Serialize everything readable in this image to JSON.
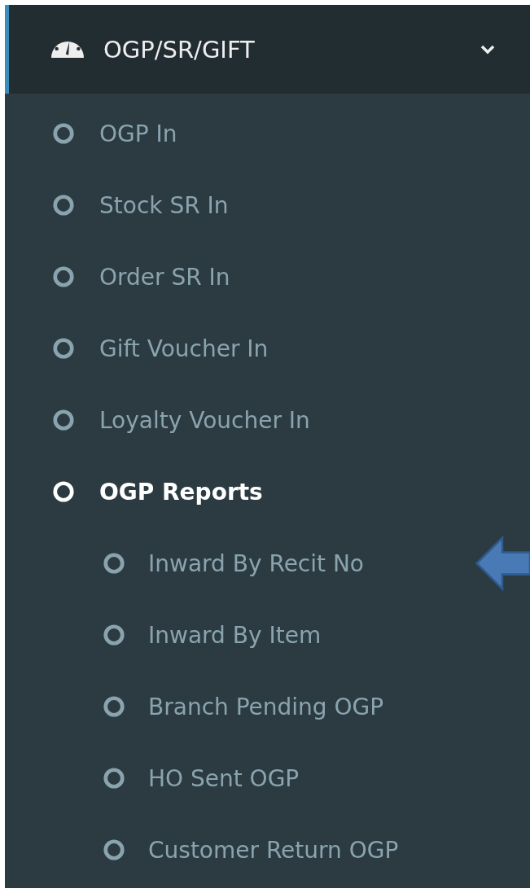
{
  "header": {
    "title": "OGP/SR/GIFT",
    "expanded": true
  },
  "items": [
    {
      "label": "OGP In",
      "active": false,
      "pointed": false
    },
    {
      "label": "Stock SR In",
      "active": false,
      "pointed": false
    },
    {
      "label": "Order SR In",
      "active": false,
      "pointed": false
    },
    {
      "label": "Gift Voucher In",
      "active": false,
      "pointed": false
    },
    {
      "label": "Loyalty Voucher In",
      "active": false,
      "pointed": false
    },
    {
      "label": "OGP Reports",
      "active": true,
      "pointed": false,
      "children": [
        {
          "label": "Inward By Recit No",
          "active": false,
          "pointed": true
        },
        {
          "label": "Inward By Item",
          "active": false,
          "pointed": false
        },
        {
          "label": "Branch Pending OGP",
          "active": false,
          "pointed": false
        },
        {
          "label": "HO Sent OGP",
          "active": false,
          "pointed": false
        },
        {
          "label": "Customer Return OGP",
          "active": false,
          "pointed": false
        }
      ]
    }
  ]
}
